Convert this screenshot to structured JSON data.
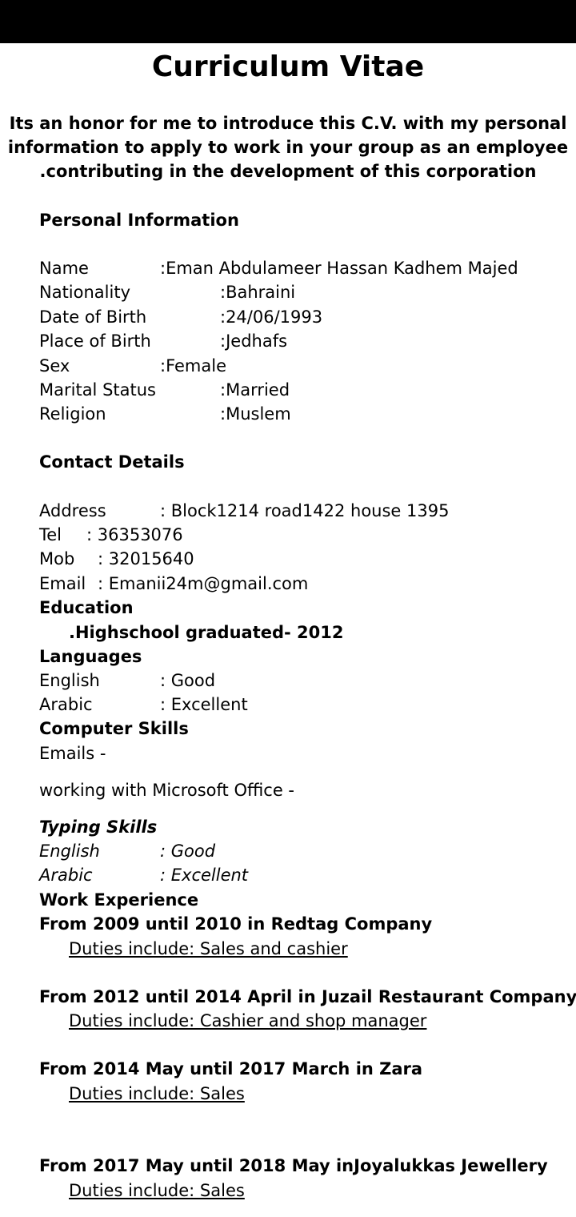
{
  "title": "Curriculum Vitae",
  "intro": [
    "Its an honor for me to introduce this C.V. with my personal",
    "information to apply to work in your group as an employee",
    ".contributing in the development of this corporation"
  ],
  "personal": {
    "heading": "Personal Information",
    "rows": [
      {
        "label": "Name",
        "value": ":Eman Abdulameer Hassan Kadhem Majed"
      },
      {
        "label": "Nationality",
        "value": ":Bahraini"
      },
      {
        "label": "Date of Birth",
        "value": ":24/06/1993"
      },
      {
        "label": "Place of Birth",
        "value": ":Jedhafs"
      },
      {
        "label": "Sex",
        "value": ":Female"
      },
      {
        "label": "Marital Status",
        "value": ":Married"
      },
      {
        "label": "Religion",
        "value": ":Muslem"
      }
    ]
  },
  "contact": {
    "heading": "Contact Details",
    "rows": [
      {
        "label": "Address",
        "value": ": Block1214 road1422 house 1395"
      },
      {
        "label": "Tel",
        "value": ": 36353076"
      },
      {
        "label": "Mob",
        "value": ": 32015640"
      },
      {
        "label": "Email",
        "value": ": Emanii24m@gmail.com"
      }
    ]
  },
  "education": {
    "heading": "Education",
    "item": ".Highschool graduated- 2012"
  },
  "languages": {
    "heading": "Languages",
    "rows": [
      {
        "label": "English",
        "value": ": Good"
      },
      {
        "label": "Arabic",
        "value": ": Excellent"
      }
    ]
  },
  "computer": {
    "heading": "Computer Skills",
    "items": [
      "Emails -",
      "working with Microsoft Office -"
    ]
  },
  "typing": {
    "heading": "Typing Skills",
    "rows": [
      {
        "label": "English",
        "value": ":  Good"
      },
      {
        "label": "Arabic",
        "value": ":  Excellent"
      }
    ]
  },
  "work": {
    "heading": "Work Experience",
    "jobs": [
      {
        "title": "From 2009 until 2010 in Redtag Company",
        "duties": "Duties include: Sales and cashier"
      },
      {
        "title": "From 2012 until 2014 April in Juzail Restaurant Company",
        "duties": "Duties include: Cashier and shop manager"
      },
      {
        "title": "From 2014 May until 2017 March in Zara",
        "duties": "Duties include: Sales"
      },
      {
        "title": "From 2017 May until 2018 May inJoyalukkas Jewellery",
        "duties": "Duties include: Sales"
      }
    ]
  }
}
